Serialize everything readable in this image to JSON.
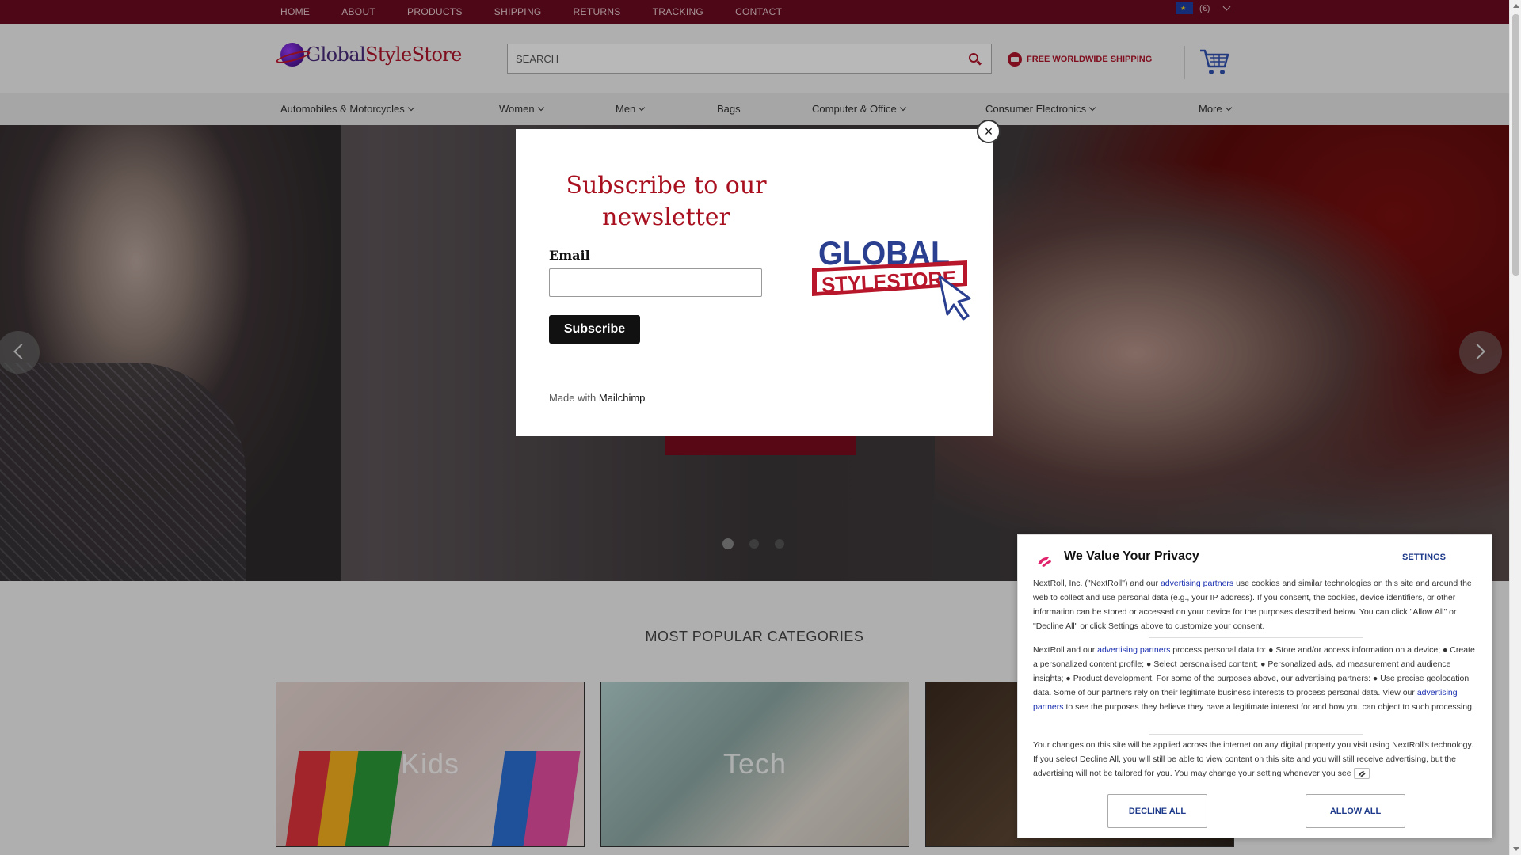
{
  "topnav": {
    "items": [
      "HOME",
      "ABOUT",
      "PRODUCTS",
      "SHIPPING",
      "RETURNS",
      "TRACKING",
      "CONTACT"
    ],
    "currency": "(€)"
  },
  "header": {
    "logo_text_a": "Global",
    "logo_text_b": "StyleStore",
    "search_placeholder": "SEARCH",
    "shipping_label": "FREE WORLDWIDE SHIPPING"
  },
  "catnav": {
    "items": [
      "Automobiles & Motorcycles",
      "Women",
      "Men",
      "Bags",
      "Computer & Office",
      "Consumer Electronics",
      "More"
    ]
  },
  "categories": {
    "title": "MOST POPULAR CATEGORIES",
    "cards": [
      "Kids",
      "Tech"
    ]
  },
  "modal": {
    "title": "Subscribe to our newsletter",
    "email_label": "Email",
    "subscribe_label": "Subscribe",
    "made_with_prefix": "Made with",
    "made_with_brand": "Mailchimp",
    "logo_line1": "GLOBAL",
    "logo_line2": "STYLESTORE",
    "close_label": "×"
  },
  "privacy": {
    "title": "We Value Your Privacy",
    "settings_label": "SETTINGS",
    "para1_a": "NextRoll, Inc. (\"NextRoll\") and our ",
    "para1_link": "advertising partners",
    "para1_b": " use cookies and similar technologies on this site and around the web to collect and use personal data (e.g., your IP address). If you consent, the cookies, device identifiers, or other information can be stored or accessed on your device for the purposes described below. You can click \"Allow All\" or \"Decline All\" or click Settings above to customize your consent.",
    "para2_a": "NextRoll and our ",
    "para2_link": "advertising partners",
    "para2_b": " process personal data to: ● Store and/or access information on a device; ● Create a personalized content profile; ● Select personalised content; ● Personalized ads, ad measurement and audience insights; ● Product development. For some of the purposes above, our advertising partners: ● Use precise geolocation data. Some of our partners rely on their legitimate business interests to process personal data. View our ",
    "para2_link2": "advertising partners",
    "para2_c": " to see the purposes they believe they have a legitimate interest for and how you can object to such processing.",
    "para3": "Your changes on this site will be applied across the internet on any digital property you visit using NextRoll's technology. If you select Decline All, you will still be able to view content on this site and you will still receive advertising, but the advertising will not be tailored for you. You may change your setting whenever you see",
    "decline_label": "DECLINE ALL",
    "allow_label": "ALLOW ALL"
  },
  "colors": {
    "brand_red": "#b0152c",
    "topbar": "#6b0a1f",
    "link_blue": "#1a2fb0"
  },
  "icons": [
    "search-icon",
    "shipping-icon",
    "cart-icon",
    "chevron-down-icon",
    "close-icon",
    "nextroll-icon",
    "arrow-left-icon",
    "arrow-right-icon",
    "eu-flag-icon"
  ],
  "slider": {
    "slides": 3,
    "active": 1
  }
}
